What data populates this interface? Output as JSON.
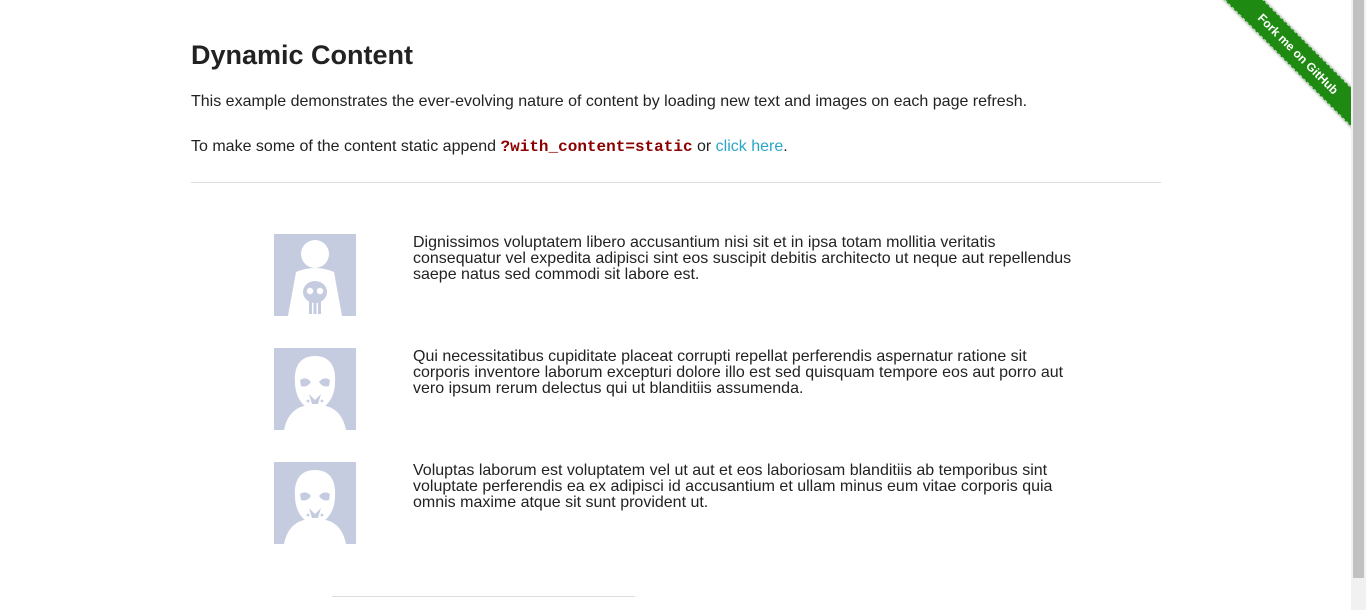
{
  "page": {
    "title": "Dynamic Content",
    "intro": "This example demonstrates the ever-evolving nature of content by loading new text and images on each page refresh.",
    "static_prefix": "To make some of the content static append ",
    "static_param": "?with_content=static",
    "static_or": " or ",
    "static_link": "click here",
    "static_suffix": "."
  },
  "rows": [
    {
      "avatar_icon": "punisher-avatar-icon",
      "text": "Dignissimos voluptatem libero accusantium nisi sit et in ipsa totam mollitia veritatis consequatur vel expedita adipisci sint eos suscipit debitis architecto ut neque aut repellendus saepe natus sed commodi sit labore est."
    },
    {
      "avatar_icon": "stormtrooper-avatar-icon",
      "text": "Qui necessitatibus cupiditate placeat corrupti repellat perferendis aspernatur ratione sit corporis inventore laborum excepturi dolore illo est sed quisquam tempore eos aut porro aut vero ipsum rerum delectus qui ut blanditiis assumenda."
    },
    {
      "avatar_icon": "stormtrooper-avatar-icon",
      "text": "Voluptas laborum est voluptatem vel ut aut et eos laboriosam blanditiis ab temporibus sint voluptate perferendis ea ex adipisci id accusantium et ullam minus eum vitae corporis quia omnis maxime atque sit sunt provident ut."
    }
  ],
  "ribbon": {
    "label": "Fork me on GitHub",
    "color": "#1e8a12"
  },
  "colors": {
    "link": "#2ba6cb",
    "code": "#8b0000",
    "avatar_bg": "#c6cce0"
  }
}
